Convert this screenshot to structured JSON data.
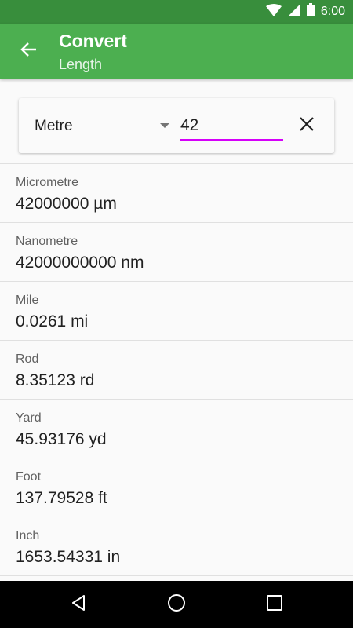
{
  "status_bar": {
    "time": "6:00",
    "icons": [
      "wifi-icon",
      "signal-icon",
      "battery-icon"
    ]
  },
  "app_bar": {
    "title": "Convert",
    "subtitle": "Length",
    "back_icon": "arrow-back-icon"
  },
  "input": {
    "unit": "Metre",
    "value": "42",
    "clear_icon": "close-icon"
  },
  "results": [
    {
      "name": "Micrometre",
      "value": "42000000 µm"
    },
    {
      "name": "Nanometre",
      "value": "42000000000 nm"
    },
    {
      "name": "Mile",
      "value": "0.0261 mi"
    },
    {
      "name": "Rod",
      "value": "8.35123 rd"
    },
    {
      "name": "Yard",
      "value": "45.93176 yd"
    },
    {
      "name": "Foot",
      "value": "137.79528 ft"
    },
    {
      "name": "Inch",
      "value": "1653.54331 in"
    }
  ],
  "nav_bar": {
    "icons": [
      "back-triangle-icon",
      "home-circle-icon",
      "recents-square-icon"
    ]
  },
  "colors": {
    "app_bar": "#4caf50",
    "status_bar": "#388e3c",
    "input_underline": "#d500f9"
  }
}
